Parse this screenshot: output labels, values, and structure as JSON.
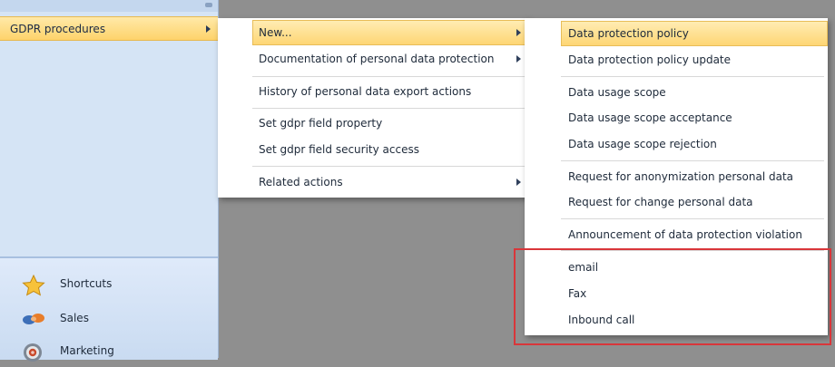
{
  "sidebar": {
    "selected_item": {
      "label": "GDPR procedures",
      "icon": "chevron-right-icon"
    },
    "nav_items": [
      {
        "label": "Shortcuts",
        "icon": "star-icon"
      },
      {
        "label": "Sales",
        "icon": "handshake-icon"
      },
      {
        "label": "Marketing",
        "icon": "target-icon"
      }
    ]
  },
  "menu_level1": {
    "items": [
      {
        "label": "New...",
        "has_submenu": true,
        "highlighted": true
      },
      {
        "label": "Documentation of personal data protection",
        "has_submenu": true
      },
      {
        "label": "History of personal data export actions",
        "has_submenu": false
      },
      {
        "label": "Set gdpr field property",
        "has_submenu": false
      },
      {
        "label": "Set gdpr field security access",
        "has_submenu": false
      },
      {
        "label": "Related actions",
        "has_submenu": true
      }
    ]
  },
  "menu_level2": {
    "items": [
      {
        "label": "Data protection policy",
        "highlighted": true
      },
      {
        "label": "Data protection policy update"
      },
      {
        "label": "Data usage scope"
      },
      {
        "label": "Data usage scope acceptance"
      },
      {
        "label": "Data usage scope rejection"
      },
      {
        "label": "Request for anonymization personal data"
      },
      {
        "label": "Request for change personal data"
      },
      {
        "label": "Announcement of data protection violation"
      },
      {
        "label": "email"
      },
      {
        "label": "Fax"
      },
      {
        "label": "Inbound call"
      }
    ]
  },
  "colors": {
    "highlight": "#fed572",
    "annotation_border": "#d9363a",
    "sidebar_bg": "#d5e4f5",
    "backdrop": "#8f8f8f"
  }
}
